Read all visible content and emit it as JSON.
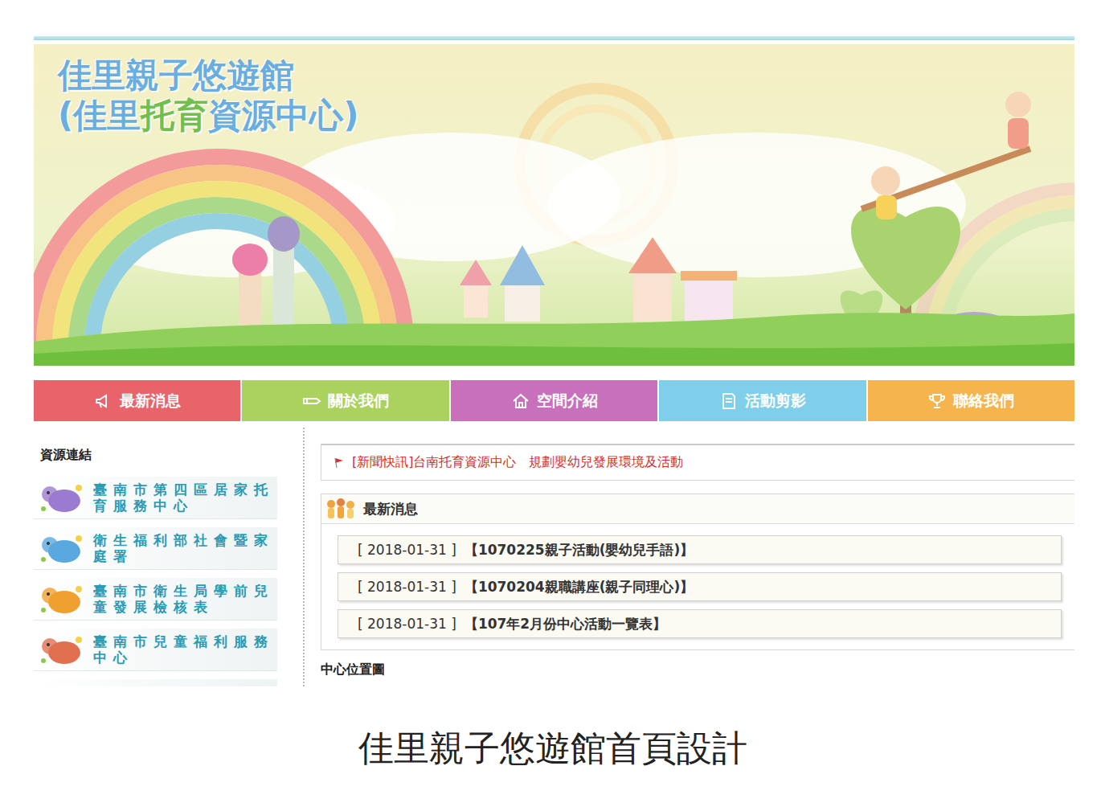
{
  "site": {
    "title": "佳里親子悠遊館",
    "subtitle": [
      {
        "text": "(佳里",
        "color": "#6aaee0"
      },
      {
        "text": "托育",
        "color": "#72bf4e"
      },
      {
        "text": "資源中心)",
        "color": "#6aaee0"
      }
    ]
  },
  "nav": [
    {
      "label": "最新消息",
      "kind": "megaphone",
      "color": "#e9636b"
    },
    {
      "label": "關於我們",
      "kind": "pencil",
      "color": "#abd15e"
    },
    {
      "label": "空間介紹",
      "kind": "house",
      "color": "#c970bc"
    },
    {
      "label": "活動剪影",
      "kind": "document",
      "color": "#80cfea"
    },
    {
      "label": "聯絡我們",
      "kind": "trophy",
      "color": "#f6b44c"
    }
  ],
  "sidebar": {
    "heading": "資源連結",
    "links": [
      {
        "label": "臺南市第四區居家托育服務中心",
        "color": "#9b7bd0"
      },
      {
        "label": "衛生福利部社會暨家庭署",
        "color": "#5aa8e0"
      },
      {
        "label": "臺南市衛生局學前兒童發展檢核表",
        "color": "#f0a030"
      },
      {
        "label": "臺南市兒童福利服務中心",
        "color": "#e07050"
      },
      {
        "label": "",
        "color": "#70b040"
      }
    ]
  },
  "ticker": {
    "text": "[新聞快訊]台南托育資源中心　規劃嬰幼兒發展環境及活動"
  },
  "news": {
    "heading": "最新消息",
    "items": [
      {
        "date": "[ 2018-01-31 ]",
        "title": "【1070225親子活動(嬰幼兒手語)】"
      },
      {
        "date": "[ 2018-01-31 ]",
        "title": "【1070204親職講座(親子同理心)】"
      },
      {
        "date": "[ 2018-01-31 ]",
        "title": "【107年2月份中心活動一覽表】"
      }
    ]
  },
  "map_heading": "中心位置圖",
  "caption": "佳里親子悠遊館首頁設計"
}
